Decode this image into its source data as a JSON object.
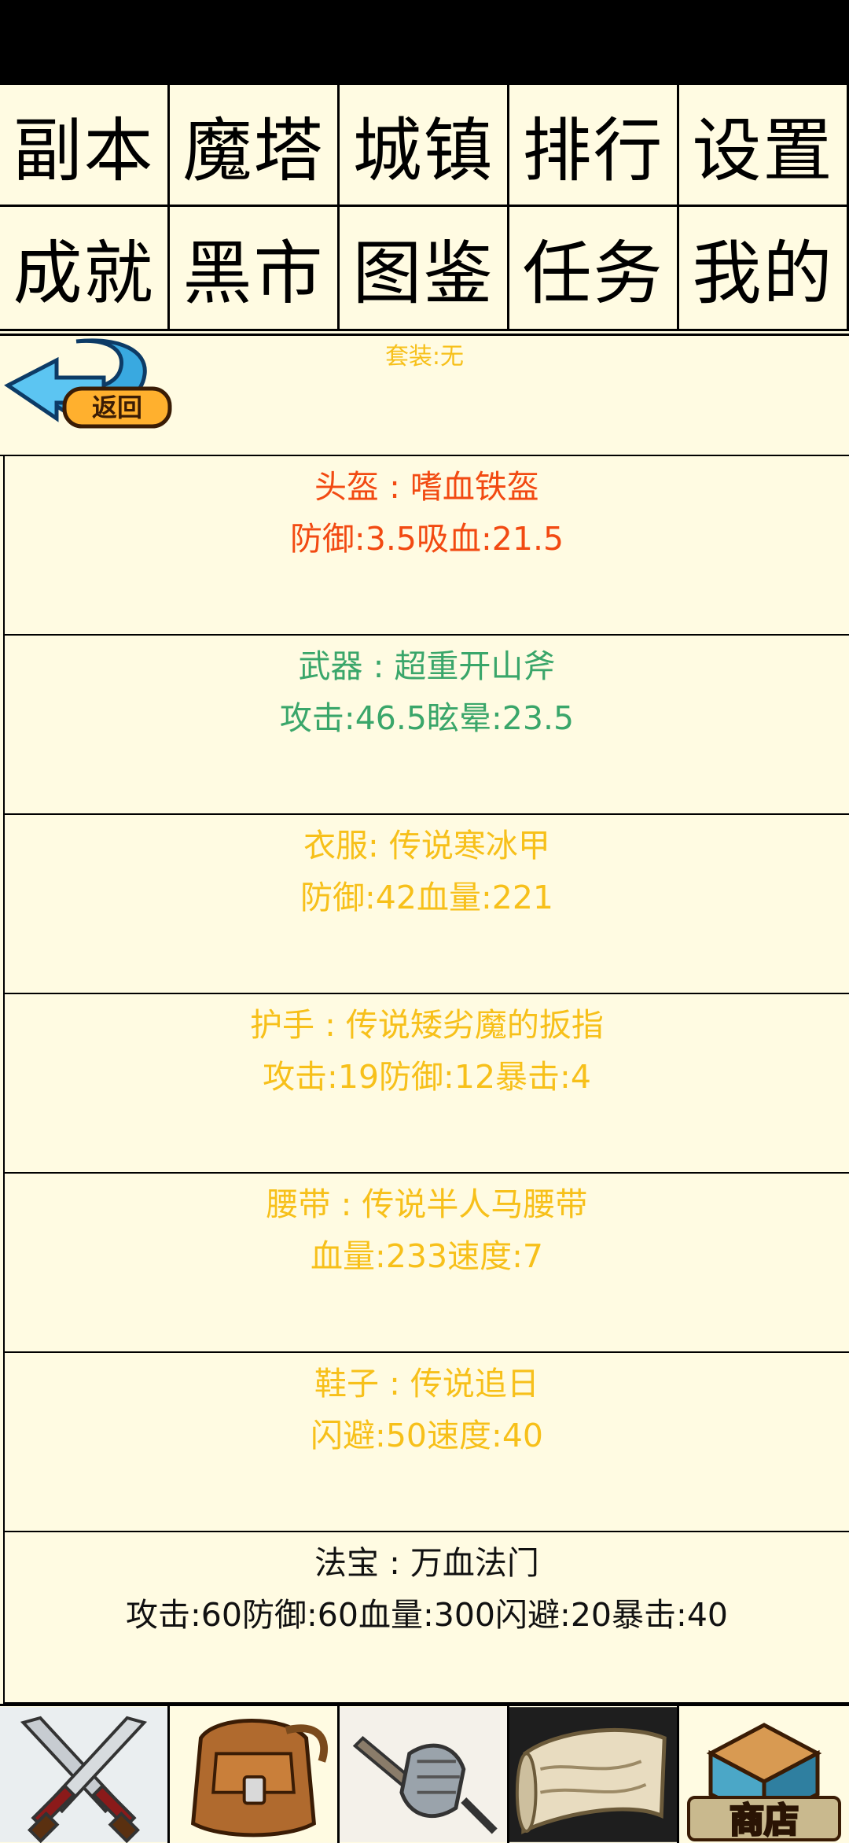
{
  "menu": {
    "row1": [
      "副本",
      "魔塔",
      "城镇",
      "排行",
      "设置"
    ],
    "row2": [
      "成就",
      "黑市",
      "图鉴",
      "任务",
      "我的"
    ]
  },
  "equip": {
    "back_label": "返回",
    "suit": "套装:无",
    "slots": [
      {
        "name": "头盔 : 嗜血铁盔",
        "stats": "防御:3.5吸血:21.5",
        "color": "#f24a12"
      },
      {
        "name": "武器 : 超重开山斧",
        "stats": "攻击:46.5眩晕:23.5",
        "color": "#3aa66a"
      },
      {
        "name": "衣服: 传说寒冰甲",
        "stats": "防御:42血量:221",
        "color": "#f7c01a"
      },
      {
        "name": "护手 : 传说矮劣魔的扳指",
        "stats": "攻击:19防御:12暴击:4",
        "color": "#f7c01a"
      },
      {
        "name": "腰带 : 传说半人马腰带",
        "stats": "血量:233速度:7",
        "color": "#f7c01a"
      },
      {
        "name": "鞋子 : 传说追日",
        "stats": "闪避:50速度:40",
        "color": "#f7c01a"
      },
      {
        "name": "法宝 : 万血法门",
        "stats": "攻击:60防御:60血量:300闪避:20暴击:40",
        "color": "#111111"
      }
    ]
  },
  "bottom_tabs": [
    {
      "icon": "crossed-swords-icon"
    },
    {
      "icon": "backpack-icon"
    },
    {
      "icon": "gauntlet-icon"
    },
    {
      "icon": "scroll-map-icon"
    },
    {
      "icon": "shop-icon",
      "label": "商店"
    }
  ]
}
